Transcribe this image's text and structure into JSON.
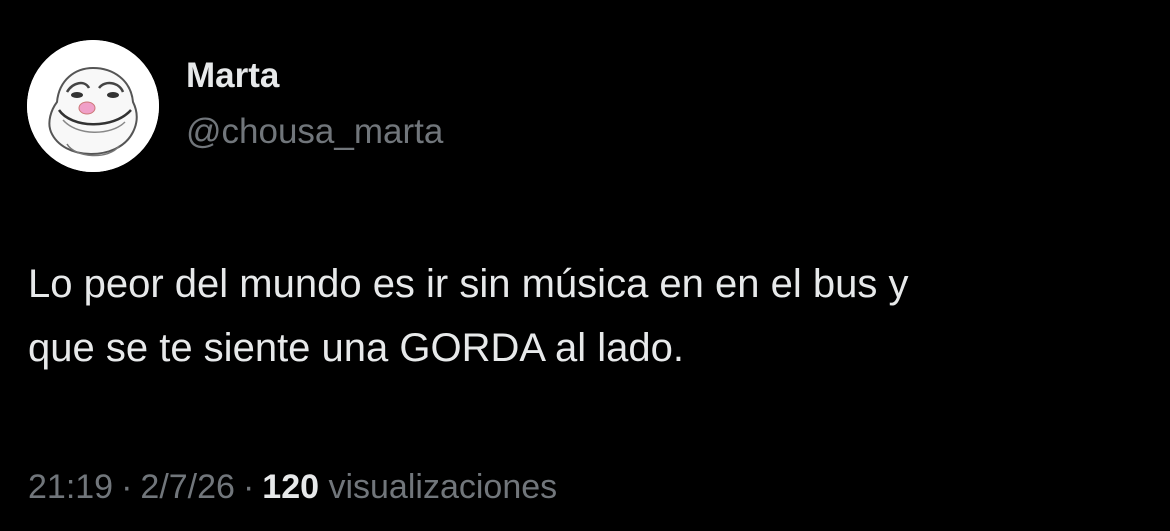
{
  "tweet": {
    "author": {
      "display_name": "Marta",
      "handle": "@chousa_marta",
      "avatar_icon": "frog-meme-avatar-icon"
    },
    "text_line_1": "Lo peor del mundo es ir sin música en en el bus y",
    "text_line_2": "que se te siente una GORDA al lado.",
    "time": "21:19",
    "date": "2/7/26",
    "separator": "·",
    "views_count": "120",
    "views_label": "visualizaciones"
  },
  "colors": {
    "background": "#000000",
    "primary_text": "#e7e9ea",
    "secondary_text": "#71767b",
    "avatar_bg": "#ffffff",
    "avatar_nose": "#f0a0c8"
  }
}
